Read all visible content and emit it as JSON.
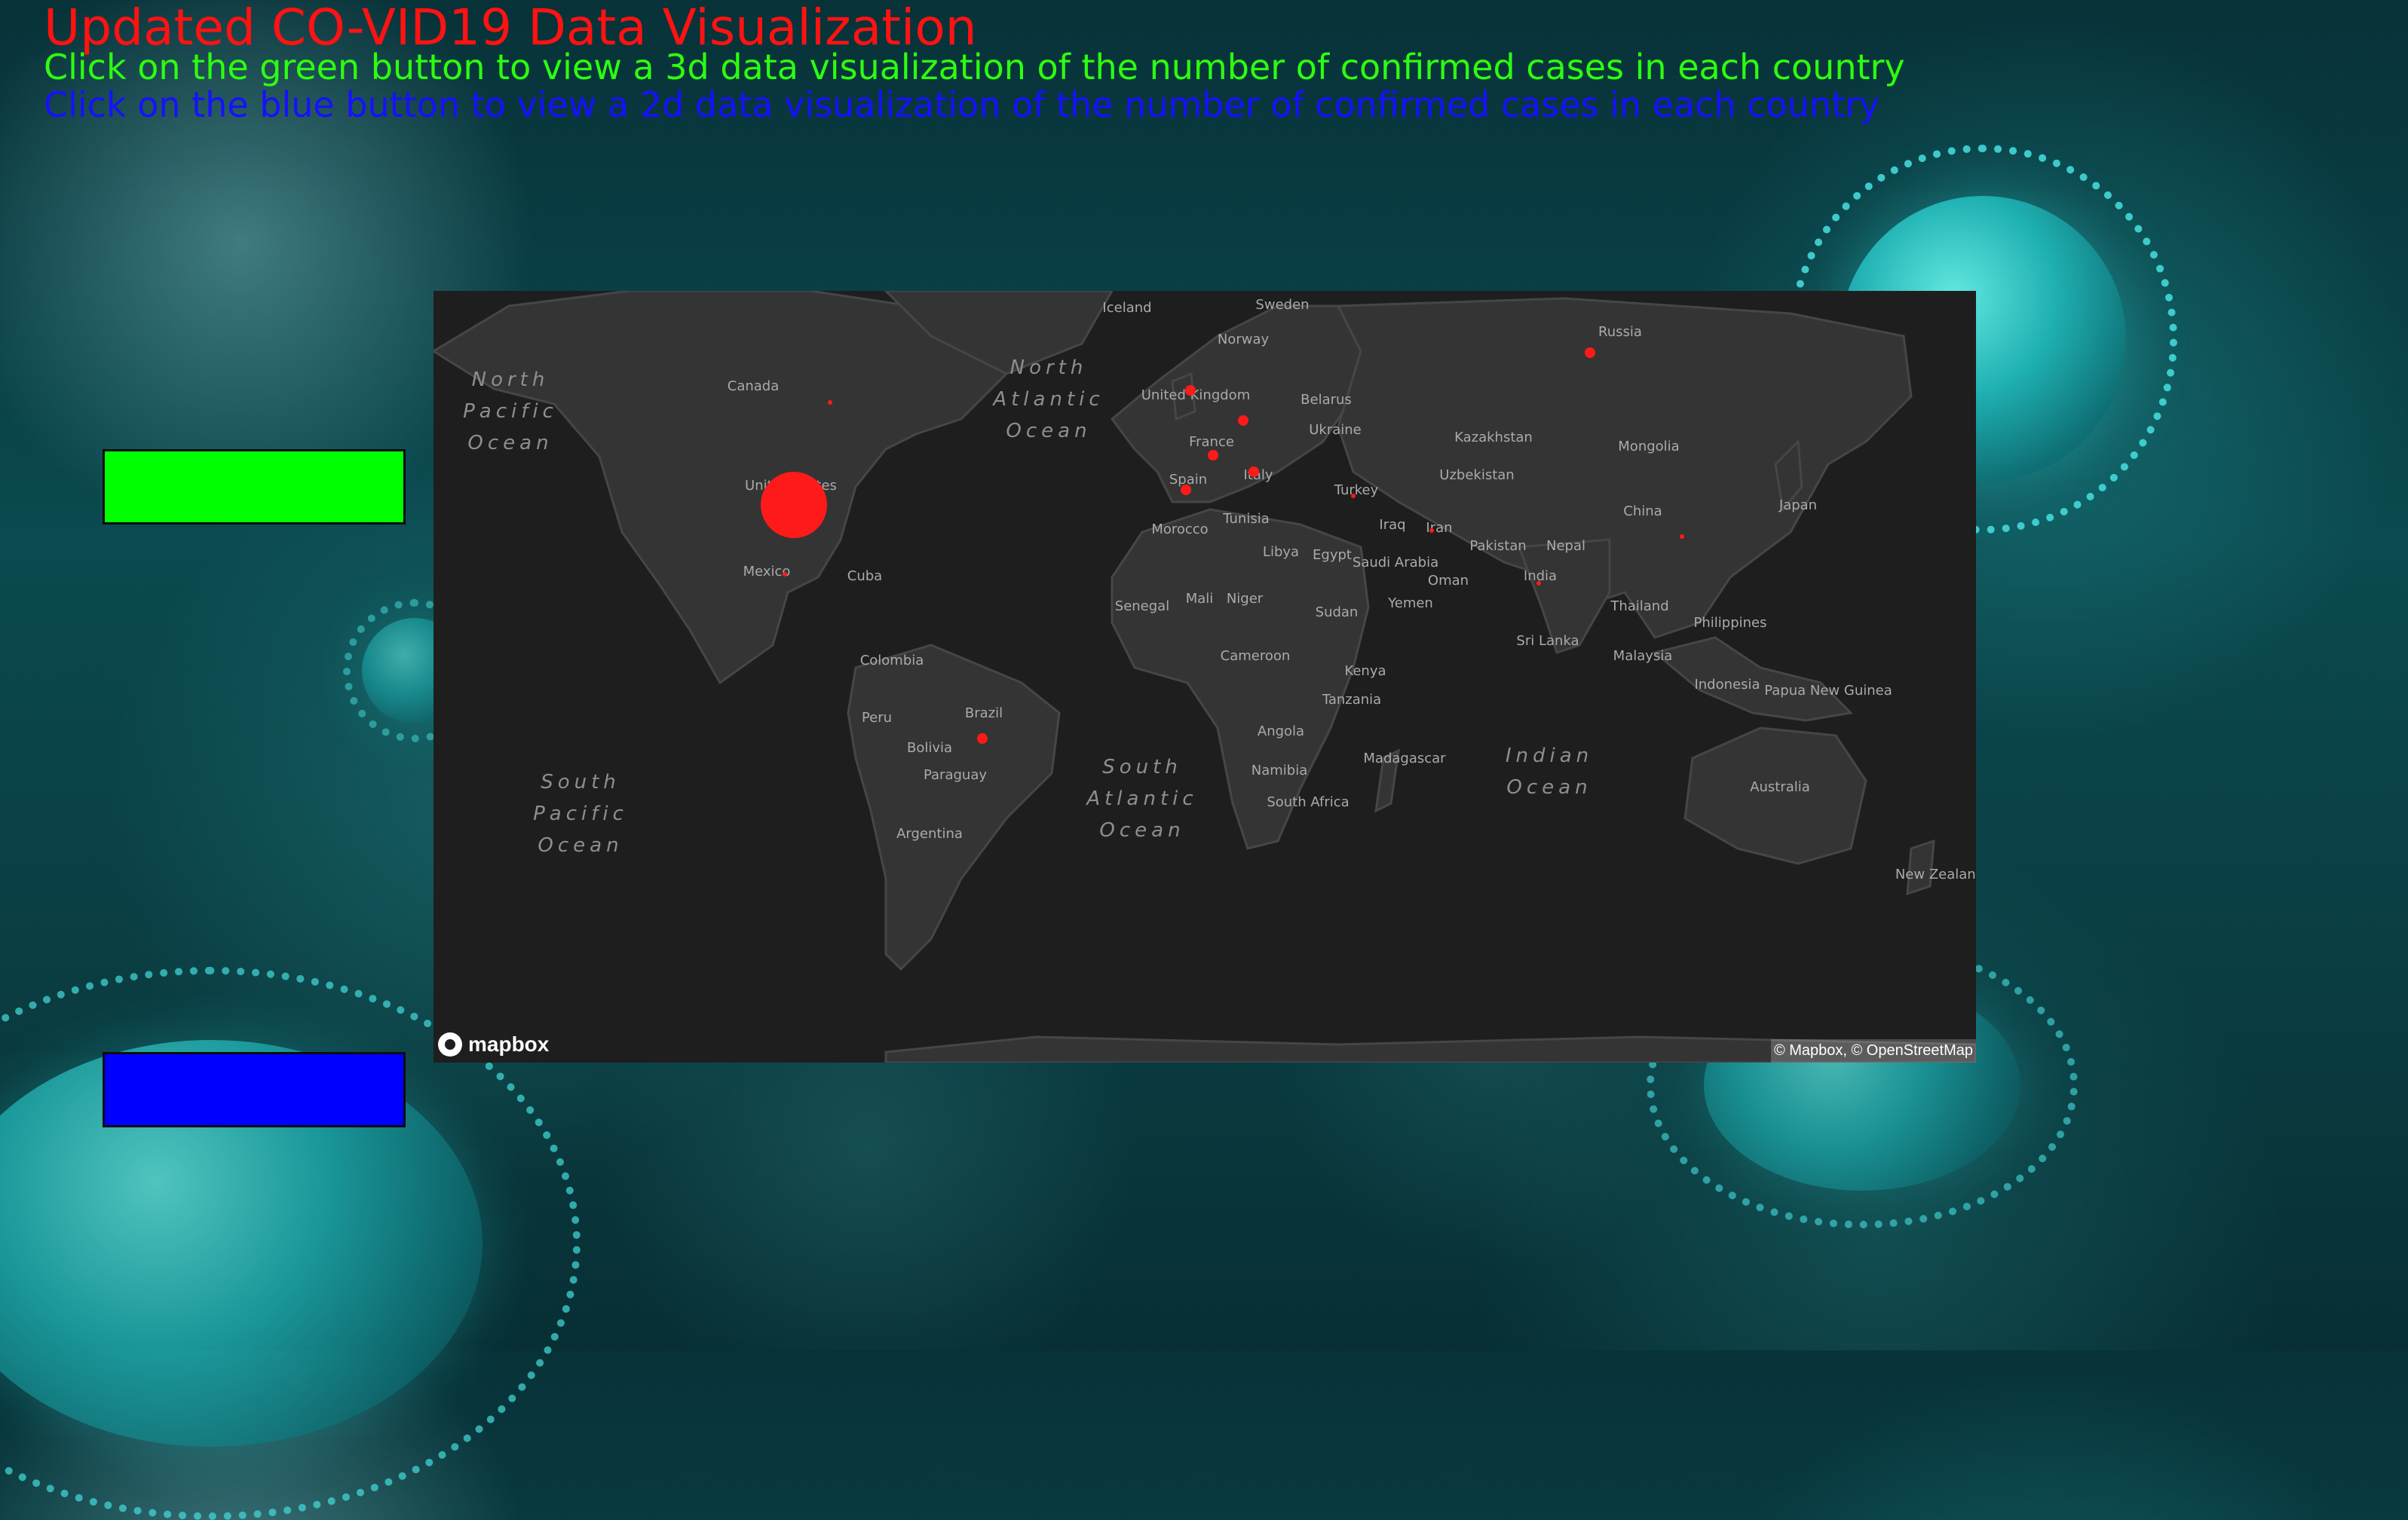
{
  "page": {
    "title": "Updated CO-VID19 Data Visualization",
    "instruction_green": "Click on the green button to view a 3d data visualization of the number of confirmed cases in each country",
    "instruction_blue": "Click on the blue button to view a 2d data visualization of the number of confirmed cases in each country"
  },
  "colors": {
    "title": "#ff1212",
    "green_text": "#2cff10",
    "blue_text": "#1710ff",
    "green_button": "#00ff00",
    "blue_button": "#0000ff",
    "map_background": "#1e1e1e",
    "case_marker": "#ff1a1a"
  },
  "buttons": [
    {
      "id": "green",
      "color": "green",
      "icon": "none"
    },
    {
      "id": "blue",
      "color": "blue",
      "icon": "none"
    }
  ],
  "map": {
    "brand": "mapbox",
    "attribution": "© Mapbox, © OpenStreetMap",
    "oceans": [
      {
        "name": "North Pacific Ocean",
        "lines": [
          "North",
          "Pacific",
          "Ocean"
        ]
      },
      {
        "name": "North Atlantic Ocean",
        "lines": [
          "North",
          "Atlantic",
          "Ocean"
        ]
      },
      {
        "name": "South Pacific Ocean",
        "lines": [
          "South",
          "Pacific",
          "Ocean"
        ]
      },
      {
        "name": "South Atlantic Ocean",
        "lines": [
          "South",
          "Atlantic",
          "Ocean"
        ]
      },
      {
        "name": "Indian Ocean",
        "lines": [
          "Indian",
          "Ocean"
        ]
      }
    ],
    "countries": [
      "Iceland",
      "Sweden",
      "Norway",
      "Russia",
      "Canada",
      "United Kingdom",
      "Belarus",
      "France",
      "Ukraine",
      "Kazakhstan",
      "Mongolia",
      "Spain",
      "Italy",
      "Turkey",
      "Uzbekistan",
      "United States",
      "Japan",
      "China",
      "Iraq",
      "Iran",
      "Morocco",
      "Tunisia",
      "Pakistan",
      "Nepal",
      "Mexico",
      "Cuba",
      "Libya",
      "Egypt",
      "Saudi Arabia",
      "Oman",
      "India",
      "Mali",
      "Niger",
      "Yemen",
      "Senegal",
      "Thailand",
      "Philippines",
      "Sudan",
      "Colombia",
      "Sri Lanka",
      "Malaysia",
      "Cameroon",
      "Kenya",
      "Indonesia",
      "Papua New Guinea",
      "Peru",
      "Brazil",
      "Tanzania",
      "Bolivia",
      "Angola",
      "Namibia",
      "Paraguay",
      "Madagascar",
      "South Africa",
      "Australia",
      "Argentina",
      "New Zealand"
    ],
    "case_markers": [
      {
        "country": "United States",
        "size": "largest"
      },
      {
        "country": "United Kingdom",
        "size": "small"
      },
      {
        "country": "Spain",
        "size": "small"
      },
      {
        "country": "Italy",
        "size": "small"
      },
      {
        "country": "France",
        "size": "small"
      },
      {
        "country": "Germany",
        "size": "small"
      },
      {
        "country": "Russia",
        "size": "small"
      },
      {
        "country": "Brazil",
        "size": "small"
      },
      {
        "country": "Turkey",
        "size": "tiny"
      },
      {
        "country": "Iran",
        "size": "tiny"
      },
      {
        "country": "India",
        "size": "tiny"
      },
      {
        "country": "China",
        "size": "tiny"
      },
      {
        "country": "Canada",
        "size": "tiny"
      },
      {
        "country": "Mexico",
        "size": "tiny"
      }
    ]
  }
}
